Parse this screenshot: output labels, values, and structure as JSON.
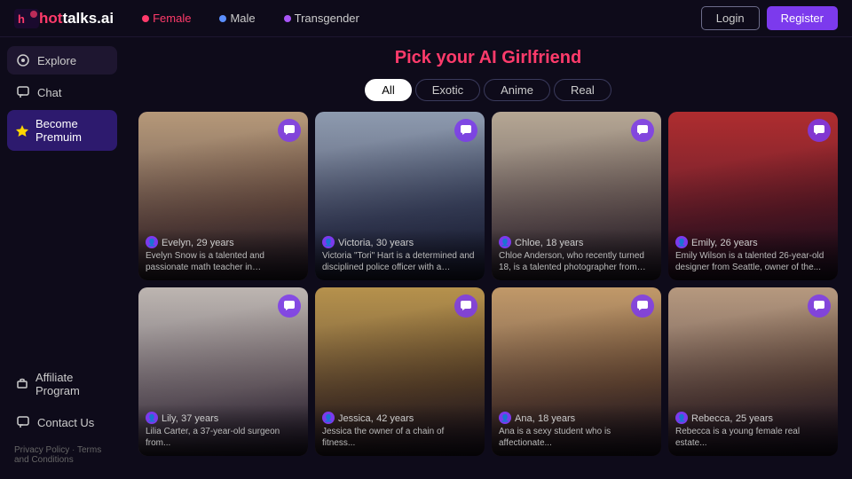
{
  "header": {
    "logo": {
      "hot": "h",
      "brand": "ottalks.ai"
    },
    "genderTabs": [
      {
        "id": "female",
        "label": "Female",
        "dotClass": "dot-female",
        "active": true
      },
      {
        "id": "male",
        "label": "Male",
        "dotClass": "dot-male",
        "active": false
      },
      {
        "id": "transgender",
        "label": "Transgender",
        "dotClass": "dot-trans",
        "active": false
      }
    ],
    "loginLabel": "Login",
    "registerLabel": "Register"
  },
  "sidebar": {
    "topItems": [
      {
        "id": "explore",
        "label": "Explore",
        "icon": "🔍",
        "active": true
      },
      {
        "id": "chat",
        "label": "Chat",
        "icon": "💬",
        "active": false
      }
    ],
    "premiumItem": {
      "id": "premium",
      "label": "Become Premuim",
      "icon": "⭐"
    },
    "bottomItems": [
      {
        "id": "affiliate",
        "label": "Affiliate Program",
        "icon": "🎁"
      },
      {
        "id": "contact",
        "label": "Contact Us",
        "icon": "💬"
      }
    ],
    "footer": {
      "privacyLabel": "Privacy Policy",
      "separator": "·",
      "termsLabel": "Terms and Conditions"
    }
  },
  "main": {
    "titlePrefix": "Pick your AI ",
    "titleAccent": "Girlfriend",
    "filterTabs": [
      {
        "id": "all",
        "label": "All",
        "active": true
      },
      {
        "id": "exotic",
        "label": "Exotic",
        "active": false
      },
      {
        "id": "anime",
        "label": "Anime",
        "active": false
      },
      {
        "id": "real",
        "label": "Real",
        "active": false
      }
    ],
    "cards": [
      {
        "id": "evelyn",
        "name": "Evelyn,",
        "age": "29 years",
        "desc": "Evelyn Snow is a talented and passionate math teacher in Vancouver,...",
        "portraitClass": "p1"
      },
      {
        "id": "victoria",
        "name": "Victoria,",
        "age": "30 years",
        "desc": "Victoria \"Tori\" Hart is a determined and disciplined police officer with a passion...",
        "portraitClass": "p2"
      },
      {
        "id": "chloe",
        "name": "Chloe,",
        "age": "18 years",
        "desc": "Chloe Anderson, who recently turned 18, is a talented photographer from Sydne...",
        "portraitClass": "p3"
      },
      {
        "id": "emily",
        "name": "Emily,",
        "age": "26 years",
        "desc": "Emily Wilson is a talented 26-year-old designer from Seattle, owner of the...",
        "portraitClass": "p4"
      },
      {
        "id": "lily",
        "name": "Lily,",
        "age": "37 years",
        "desc": "Lilia Carter, a 37-year-old surgeon from...",
        "portraitClass": "p5"
      },
      {
        "id": "jessica",
        "name": "Jessica,",
        "age": "42 years",
        "desc": "Jessica the owner of a chain of fitness...",
        "portraitClass": "p6"
      },
      {
        "id": "ana",
        "name": "Ana,",
        "age": "18 years",
        "desc": "Ana is a sexy student who is affectionate...",
        "portraitClass": "p7"
      },
      {
        "id": "rebecca",
        "name": "Rebecca,",
        "age": "25 years",
        "desc": "Rebecca is a young female real estate...",
        "portraitClass": "p8"
      }
    ]
  }
}
